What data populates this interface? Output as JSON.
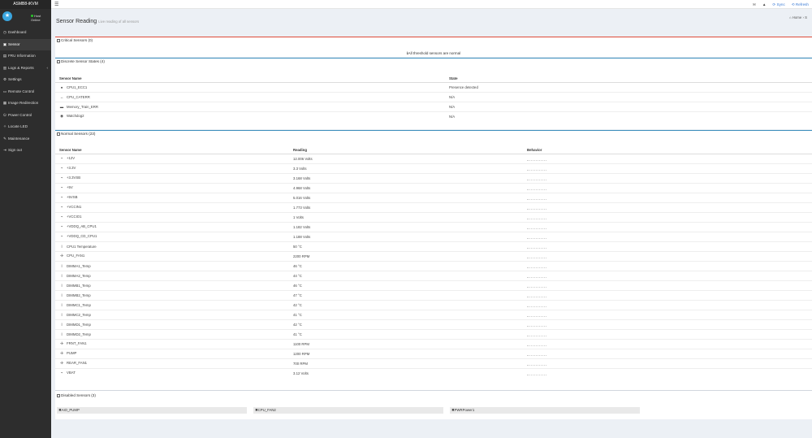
{
  "app": {
    "brand": "ASMB8-iKVM",
    "status_line1": "Host",
    "status_line2": "Online"
  },
  "sidebar": {
    "items": [
      {
        "label": "Dashboard",
        "icon": "dashboard-icon",
        "glyph": "◷"
      },
      {
        "label": "Sensor",
        "icon": "sensor-icon",
        "glyph": "▣",
        "active": true
      },
      {
        "label": "FRU Information",
        "icon": "fru-icon",
        "glyph": "▤"
      },
      {
        "label": "Logs & Reports",
        "icon": "chart-icon",
        "glyph": "▥",
        "caret": "‹"
      },
      {
        "label": "Settings",
        "icon": "gear-icon",
        "glyph": "⚙"
      },
      {
        "label": "Remote Control",
        "icon": "monitor-icon",
        "glyph": "▭"
      },
      {
        "label": "Image Redirection",
        "icon": "image-icon",
        "glyph": "▦"
      },
      {
        "label": "Power Control",
        "icon": "power-icon",
        "glyph": "⏻"
      },
      {
        "label": "Locate LED",
        "icon": "lightbulb-icon",
        "glyph": "✧"
      },
      {
        "label": "Maintenance",
        "icon": "wrench-icon",
        "glyph": "✎"
      },
      {
        "label": "Sign out",
        "icon": "signout-icon",
        "glyph": "⇥"
      }
    ]
  },
  "topbar": {
    "sync": "Sync",
    "refresh": "Refresh"
  },
  "header": {
    "title": "Sensor Reading",
    "subtitle": "Live reading of all sensors",
    "crumb_home": "Home",
    "crumb_sep": "›",
    "crumb_current": "S"
  },
  "critical": {
    "title": "Critical Sensors (0)",
    "message": "All threshold sensors are normal"
  },
  "discrete": {
    "title": "Discrete Sensor States (4)",
    "col_name": "Sensor Name",
    "col_state": "State",
    "rows": [
      {
        "icon": "info-icon",
        "glyph": "●",
        "name": "CPU1_ECC1",
        "state": "Presence detected"
      },
      {
        "icon": "arrows-icon",
        "glyph": "↔",
        "name": "CPU_CATERR",
        "state": "N/A"
      },
      {
        "icon": "hdd-icon",
        "glyph": "▬",
        "name": "Memory_Train_ERR",
        "state": "N/A"
      },
      {
        "icon": "eye-icon",
        "glyph": "◉",
        "name": "Watchdog2",
        "state": "N/A"
      }
    ]
  },
  "normal": {
    "title": "Normal Sensors (23)",
    "col_name": "Sensor Name",
    "col_reading": "Reading",
    "col_behavior": "Behavior",
    "rows": [
      {
        "icon": "voltage-icon",
        "glyph": "⌁",
        "name": "+12V",
        "reading": "12.006 Volts"
      },
      {
        "icon": "voltage-icon",
        "glyph": "⌁",
        "name": "+3.3V",
        "reading": "3.3 Volts"
      },
      {
        "icon": "voltage-icon",
        "glyph": "⌁",
        "name": "+3.3VSB",
        "reading": "3.168 Volts"
      },
      {
        "icon": "voltage-icon",
        "glyph": "⌁",
        "name": "+5V",
        "reading": "4.968 Volts"
      },
      {
        "icon": "voltage-icon",
        "glyph": "⌁",
        "name": "+5VSB",
        "reading": "5.016 Volts"
      },
      {
        "icon": "voltage-icon",
        "glyph": "⌁",
        "name": "+VCCIN1",
        "reading": "1.773 Volts"
      },
      {
        "icon": "voltage-icon",
        "glyph": "⌁",
        "name": "+VCCIO1",
        "reading": "1 Volts"
      },
      {
        "icon": "voltage-icon",
        "glyph": "⌁",
        "name": "+VDDQ_AB_CPU1",
        "reading": "1.182 Volts"
      },
      {
        "icon": "voltage-icon",
        "glyph": "⌁",
        "name": "+VDDQ_CD_CPU1",
        "reading": "1.188 Volts"
      },
      {
        "icon": "thermometer-icon",
        "glyph": "ǀ",
        "name": "CPU1 Temperature",
        "reading": "50 °C"
      },
      {
        "icon": "fan-icon",
        "glyph": "✢",
        "name": "CPU_FAN1",
        "reading": "2200 RPM"
      },
      {
        "icon": "thermometer-icon",
        "glyph": "ǀ",
        "name": "DIMMA1_Temp",
        "reading": "46 °C"
      },
      {
        "icon": "thermometer-icon",
        "glyph": "ǀ",
        "name": "DIMMA2_Temp",
        "reading": "44 °C"
      },
      {
        "icon": "thermometer-icon",
        "glyph": "ǀ",
        "name": "DIMMB1_Temp",
        "reading": "46 °C"
      },
      {
        "icon": "thermometer-icon",
        "glyph": "ǀ",
        "name": "DIMMB2_Temp",
        "reading": "47 °C"
      },
      {
        "icon": "thermometer-icon",
        "glyph": "ǀ",
        "name": "DIMMC1_Temp",
        "reading": "42 °C"
      },
      {
        "icon": "thermometer-icon",
        "glyph": "ǀ",
        "name": "DIMMC2_Temp",
        "reading": "41 °C"
      },
      {
        "icon": "thermometer-icon",
        "glyph": "ǀ",
        "name": "DIMMD1_Temp",
        "reading": "42 °C"
      },
      {
        "icon": "thermometer-icon",
        "glyph": "ǀ",
        "name": "DIMMD2_Temp",
        "reading": "41 °C"
      },
      {
        "icon": "fan-icon",
        "glyph": "✢",
        "name": "FRNT_FAN1",
        "reading": "1100 RPM"
      },
      {
        "icon": "fan-icon",
        "glyph": "✢",
        "name": "PUMP",
        "reading": "1200 RPM"
      },
      {
        "icon": "fan-icon",
        "glyph": "✢",
        "name": "REAR_FAN1",
        "reading": "700 RPM"
      },
      {
        "icon": "voltage-icon",
        "glyph": "⌁",
        "name": "VBAT",
        "reading": "3.12 Volts"
      }
    ]
  },
  "disabled": {
    "title": "Disabled Sensors (3)",
    "items": [
      "AIO_PUMP",
      "CPU_FAN2",
      "PWRPower1"
    ]
  },
  "colors": {
    "sidebar": "#2d2d2d",
    "accent": "#3c8dbc",
    "critical": "#dd4b39"
  }
}
